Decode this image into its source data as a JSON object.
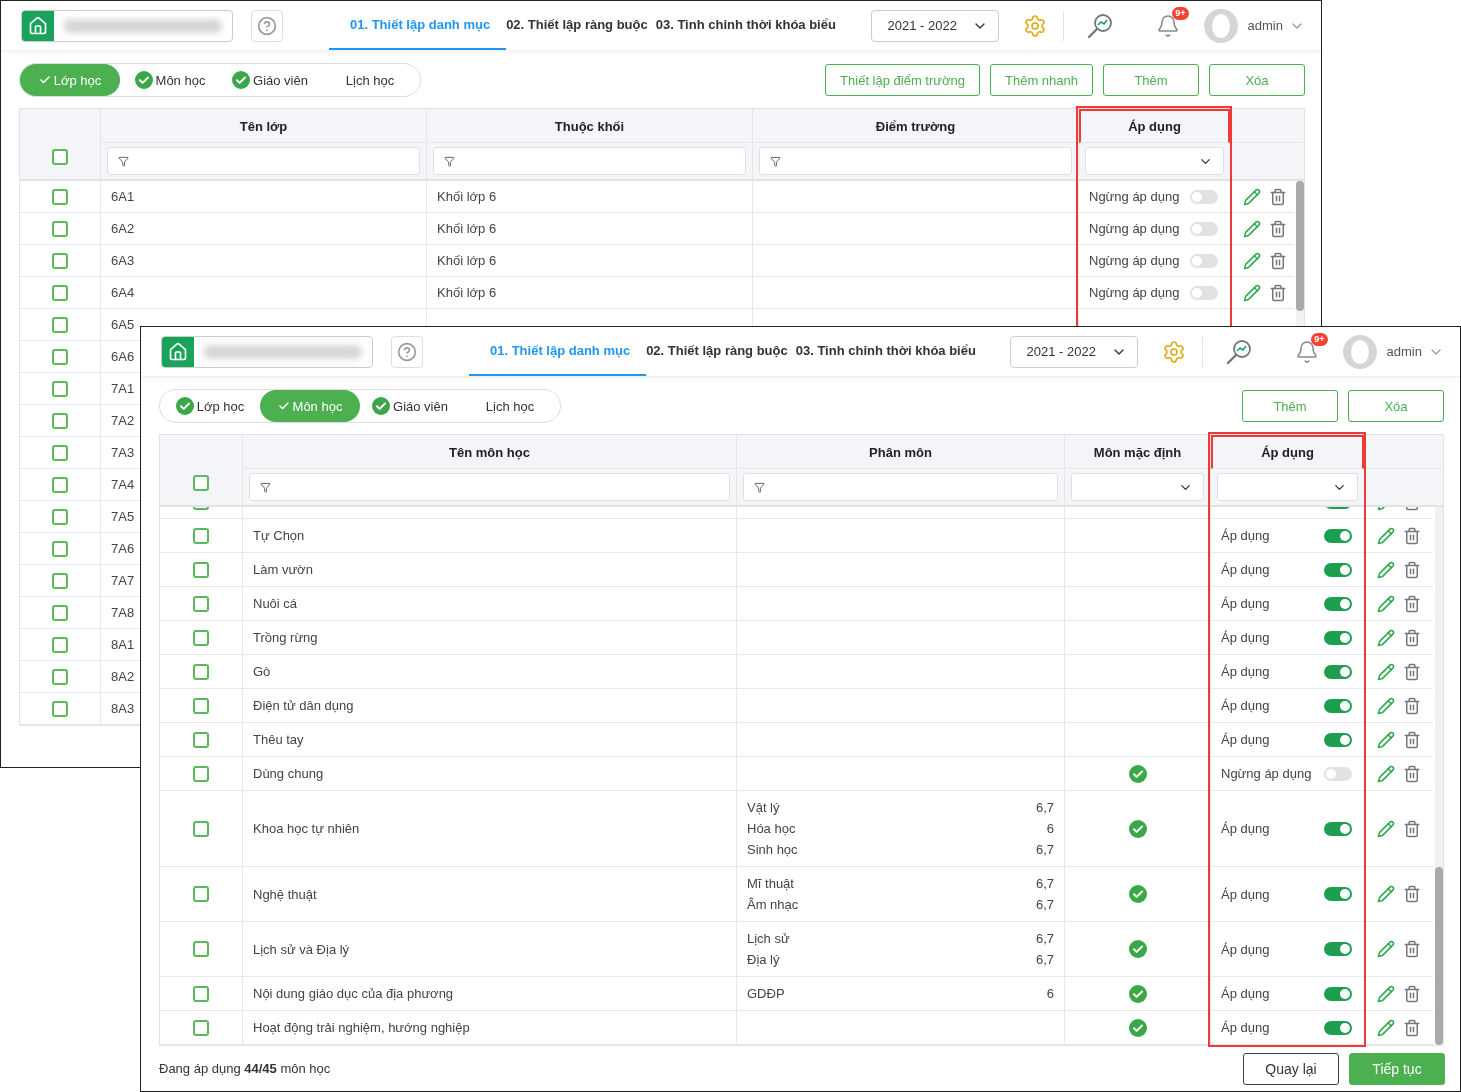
{
  "windows": [
    {
      "header": {
        "steps": [
          {
            "label": "01. Thiết lập danh mục",
            "selected": true
          },
          {
            "label": "02. Thiết lập ràng buộc",
            "selected": false
          },
          {
            "label": "03. Tinh chỉnh thời khóa biểu",
            "selected": false
          }
        ],
        "year": "2021 - 2022",
        "notifications": "9+",
        "user": "admin"
      },
      "sections": [
        {
          "label": "Lớp học",
          "selected": true,
          "done": false
        },
        {
          "label": "Môn học",
          "selected": false,
          "done": true
        },
        {
          "label": "Giáo viên",
          "selected": false,
          "done": true
        },
        {
          "label": "Lịch học",
          "selected": false,
          "done": false
        }
      ],
      "actions": [
        "Thiết lập điểm trường",
        "Thêm nhanh",
        "Thêm",
        "Xóa"
      ],
      "table": {
        "select_all_checked": false,
        "columns": [
          {
            "kind": "name",
            "title": "Tên lớp",
            "highlighted": false
          },
          {
            "kind": "block",
            "title": "Thuộc khối",
            "highlighted": false
          },
          {
            "kind": "campus",
            "title": "Điểm trường",
            "highlighted": false
          },
          {
            "kind": "status",
            "title": "Áp dụng",
            "highlighted": true
          }
        ],
        "rows": [
          {
            "checked": false,
            "name": "6A1",
            "block": "Khối lớp 6",
            "status": {
              "label": "Ngừng áp dụng",
              "on": false
            }
          },
          {
            "checked": false,
            "name": "6A2",
            "block": "Khối lớp 6",
            "status": {
              "label": "Ngừng áp dụng",
              "on": false
            }
          },
          {
            "checked": false,
            "name": "6A3",
            "block": "Khối lớp 6",
            "status": {
              "label": "Ngừng áp dụng",
              "on": false
            }
          },
          {
            "checked": false,
            "name": "6A4",
            "block": "Khối lớp 6",
            "status": {
              "label": "Ngừng áp dụng",
              "on": false
            }
          },
          {
            "checked": false,
            "name": "6A5"
          },
          {
            "checked": false,
            "name": "6A6"
          },
          {
            "checked": false,
            "name": "7A1"
          },
          {
            "checked": false,
            "name": "7A2"
          },
          {
            "checked": false,
            "name": "7A3"
          },
          {
            "checked": false,
            "name": "7A4"
          },
          {
            "checked": false,
            "name": "7A5"
          },
          {
            "checked": false,
            "name": "7A6"
          },
          {
            "checked": false,
            "name": "7A7"
          },
          {
            "checked": false,
            "name": "7A8"
          },
          {
            "checked": false,
            "name": "8A1"
          },
          {
            "checked": false,
            "name": "8A2"
          },
          {
            "checked": false,
            "name": "8A3"
          }
        ]
      }
    },
    {
      "header": {
        "steps": [
          {
            "label": "01. Thiết lập danh mục",
            "selected": true
          },
          {
            "label": "02. Thiết lập ràng buộc",
            "selected": false
          },
          {
            "label": "03. Tinh chỉnh thời khóa biểu",
            "selected": false
          }
        ],
        "year": "2021 - 2022",
        "notifications": "9+",
        "user": "admin"
      },
      "sections": [
        {
          "label": "Lớp học",
          "selected": false,
          "done": true
        },
        {
          "label": "Môn học",
          "selected": true,
          "done": false
        },
        {
          "label": "Giáo viên",
          "selected": false,
          "done": true
        },
        {
          "label": "Lịch học",
          "selected": false,
          "done": false
        }
      ],
      "actions": [
        "Thêm",
        "Xóa"
      ],
      "table": {
        "select_all_checked": false,
        "columns": [
          {
            "kind": "name",
            "title": "Tên môn học",
            "highlighted": false
          },
          {
            "kind": "parts",
            "title": "Phân môn",
            "highlighted": false
          },
          {
            "kind": "default",
            "title": "Môn mặc định",
            "highlighted": false
          },
          {
            "kind": "status",
            "title": "Áp dụng",
            "highlighted": true
          }
        ],
        "rows": [
          {
            "checked": false,
            "status": {
              "on": true
            }
          },
          {
            "checked": false,
            "name": "Tự Chọn",
            "default": false,
            "status": {
              "label": "Áp dụng",
              "on": true
            }
          },
          {
            "checked": false,
            "name": "Làm vườn",
            "default": false,
            "status": {
              "label": "Áp dụng",
              "on": true
            }
          },
          {
            "checked": false,
            "name": "Nuôi cá",
            "default": false,
            "status": {
              "label": "Áp dụng",
              "on": true
            }
          },
          {
            "checked": false,
            "name": "Trồng rừng",
            "default": false,
            "status": {
              "label": "Áp dụng",
              "on": true
            }
          },
          {
            "checked": false,
            "name": "Gò",
            "default": false,
            "status": {
              "label": "Áp dụng",
              "on": true
            }
          },
          {
            "checked": false,
            "name": "Điện tử dân dụng",
            "default": false,
            "status": {
              "label": "Áp dụng",
              "on": true
            }
          },
          {
            "checked": false,
            "name": "Thêu tay",
            "default": false,
            "status": {
              "label": "Áp dụng",
              "on": true
            }
          },
          {
            "checked": false,
            "name": "Dùng chung",
            "default": true,
            "status": {
              "label": "Ngừng áp dụng",
              "on": false
            }
          },
          {
            "checked": false,
            "name": "Khoa học tự nhiên",
            "parts": [
              {
                "name": "Vật lý",
                "coef": "6,7"
              },
              {
                "name": "Hóa học",
                "coef": "6"
              },
              {
                "name": "Sinh học",
                "coef": "6,7"
              }
            ],
            "default": true,
            "status": {
              "label": "Áp dụng",
              "on": true
            }
          },
          {
            "checked": false,
            "name": "Nghệ thuật",
            "parts": [
              {
                "name": "Mĩ thuật",
                "coef": "6,7"
              },
              {
                "name": "Âm nhạc",
                "coef": "6,7"
              }
            ],
            "default": true,
            "status": {
              "label": "Áp dụng",
              "on": true
            }
          },
          {
            "checked": false,
            "name": "Lịch sử và Địa lý",
            "parts": [
              {
                "name": "Lịch sử",
                "coef": "6,7"
              },
              {
                "name": "Địa lý",
                "coef": "6,7"
              }
            ],
            "default": true,
            "status": {
              "label": "Áp dụng",
              "on": true
            }
          },
          {
            "checked": false,
            "name": "Nội dung giáo dục của địa phương",
            "parts": [
              {
                "name": "GDĐP",
                "coef": "6"
              }
            ],
            "default": true,
            "status": {
              "label": "Áp dụng",
              "on": true
            }
          },
          {
            "checked": false,
            "name": "Hoạt động trải nghiệm, hướng nghiệp",
            "default": true,
            "status": {
              "label": "Áp dụng",
              "on": true
            }
          }
        ]
      },
      "footer": {
        "summary": "Đang áp dụng **44/45** môn học",
        "buttons": [
          {
            "label": "Quay lại",
            "kind": "secondary"
          },
          {
            "label": "Tiếp tục",
            "kind": "primary"
          }
        ]
      }
    }
  ]
}
